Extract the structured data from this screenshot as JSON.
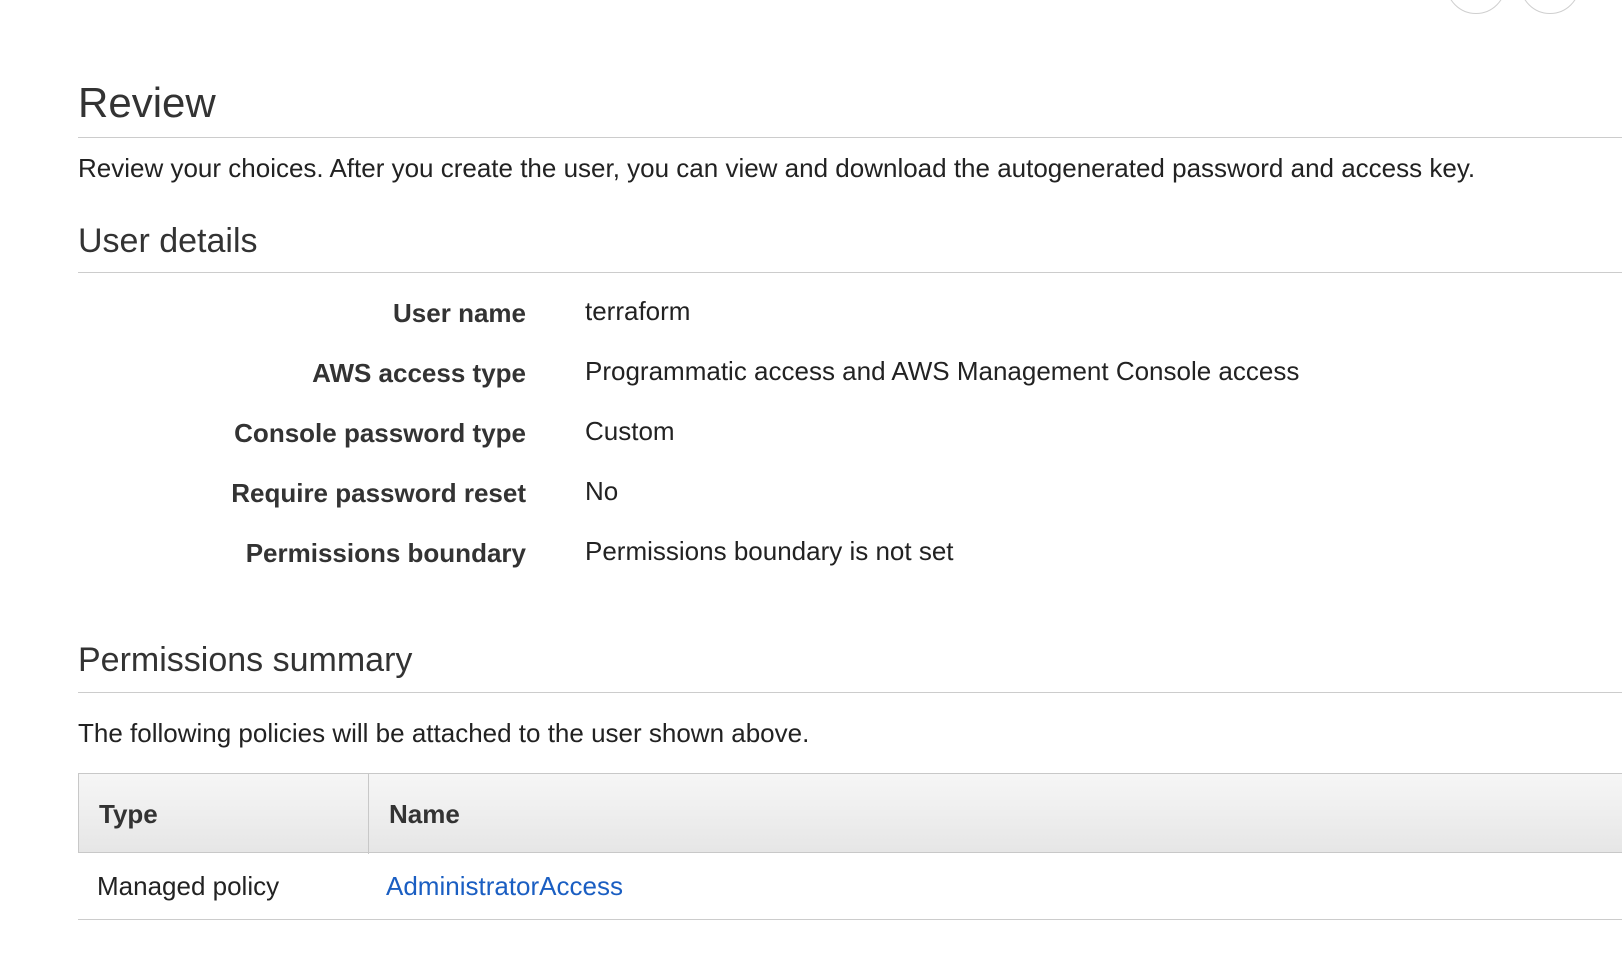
{
  "page": {
    "title": "Review",
    "intro": "Review your choices. After you create the user, you can view and download the autogenerated password and access key."
  },
  "user_details": {
    "heading": "User details",
    "rows": [
      {
        "label": "User name",
        "value": "terraform"
      },
      {
        "label": "AWS access type",
        "value": "Programmatic access and AWS Management Console access"
      },
      {
        "label": "Console password type",
        "value": "Custom"
      },
      {
        "label": "Require password reset",
        "value": "No"
      },
      {
        "label": "Permissions boundary",
        "value": "Permissions boundary is not set"
      }
    ]
  },
  "permissions_summary": {
    "heading": "Permissions summary",
    "description": "The following policies will be attached to the user shown above.",
    "table": {
      "headers": {
        "type": "Type",
        "name": "Name"
      },
      "rows": [
        {
          "type": "Managed policy",
          "name": "AdministratorAccess"
        }
      ]
    }
  },
  "colors": {
    "link": "#1a5ec2",
    "rule": "#cccccc",
    "header_bg": "#ececec"
  }
}
